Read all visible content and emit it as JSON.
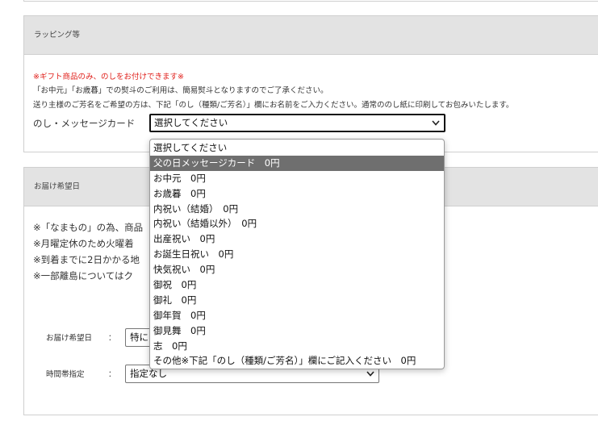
{
  "wrapping": {
    "header": "ラッピング等",
    "note_red": "※ギフト商品のみ、のしをお付けできます※",
    "note_1": "「お中元」「お歳暮」での熨斗のご利用は、簡易熨斗となりますのでご了承ください。",
    "note_2": "送り主様のご芳名をご希望の方は、下記「のし（種類/ご芳名）」欄にお名前をご入力ください。通常ののし紙に印刷してお包みいたします。",
    "field_label": "のし・メッセージカード",
    "field_value": "選択してください",
    "options": [
      "選択してください",
      "父の日メッセージカード　0円",
      "お中元　0円",
      "お歳暮　0円",
      "内祝い（結婚）　0円",
      "内祝い（結婚以外）　0円",
      "出産祝い　0円",
      "お誕生日祝い　0円",
      "快気祝い　0円",
      "御祝　0円",
      "御礼　0円",
      "御年賀　0円",
      "御見舞　0円",
      "志　0円",
      "その他※下記「のし（種類/ご芳名）」欄にご記入ください　0円"
    ],
    "highlighted_option": "父の日メッセージカード　0円"
  },
  "delivery": {
    "header": "お届け希望日",
    "lines": [
      "※「なまもの」の為、商品",
      "※月曜定休のため火曜着",
      "※到着までに2日かかる地",
      "※一部離島についてはク"
    ],
    "date_label": "お届け希望日",
    "date_colon": "：",
    "date_value": "特に",
    "time_label": "時間帯指定",
    "time_colon": "：",
    "time_value": "指定なし"
  },
  "icons": {
    "select_arrow": "chevron-down-icon"
  },
  "colors": {
    "note_red": "#e0201b",
    "header_bg": "#e3e3e3",
    "highlight_bg": "#6f6f6f"
  }
}
